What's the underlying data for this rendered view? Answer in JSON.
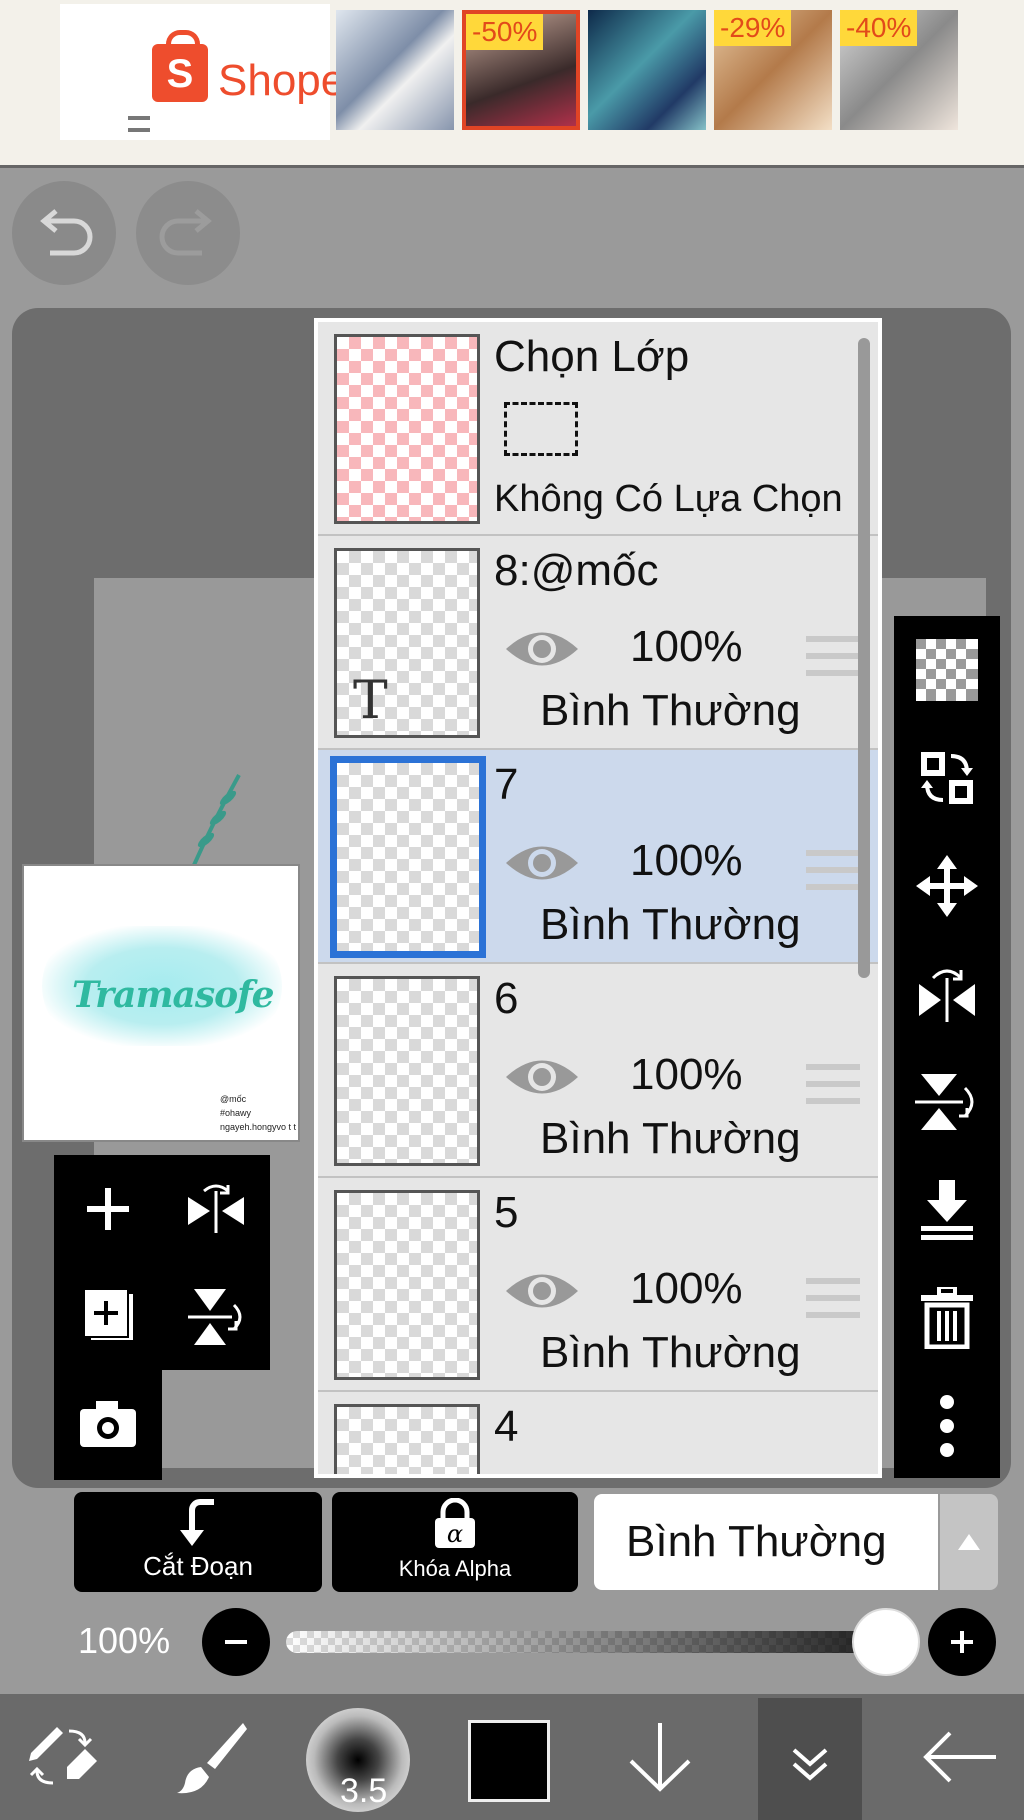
{
  "ad": {
    "brand": "Shopee",
    "badges": [
      "-50%",
      "-29%",
      "-40%"
    ]
  },
  "layers_panel": {
    "selection": {
      "title": "Chọn Lớp",
      "status": "Không Có Lựa Chọn"
    },
    "layers": [
      {
        "name": "8:@mốc",
        "opacity": "100%",
        "blend": "Bình Thường"
      },
      {
        "name": "7",
        "opacity": "100%",
        "blend": "Bình Thường",
        "selected": true
      },
      {
        "name": "6",
        "opacity": "100%",
        "blend": "Bình Thường"
      },
      {
        "name": "5",
        "opacity": "100%",
        "blend": "Bình Thường"
      },
      {
        "name": "4"
      }
    ]
  },
  "preview": {
    "title": "Tramasofe",
    "small_lines": [
      "@mốc",
      "#ohawy",
      "ngayeh.hongyvo t t"
    ]
  },
  "bottom_controls": {
    "clip_label": "Cắt Đoạn",
    "alpha_label": "Khóa Alpha",
    "blend_mode": "Bình Thường",
    "layer_opacity_label": "100%",
    "layer_opacity_value": 1.0
  },
  "toolbar": {
    "brush_size": "3.5",
    "current_color": "#000000"
  },
  "colors": {
    "selected_layer_bg": "#ccd9ec",
    "selected_outline": "#2b72d6",
    "shopee": "#ee4d2d"
  }
}
